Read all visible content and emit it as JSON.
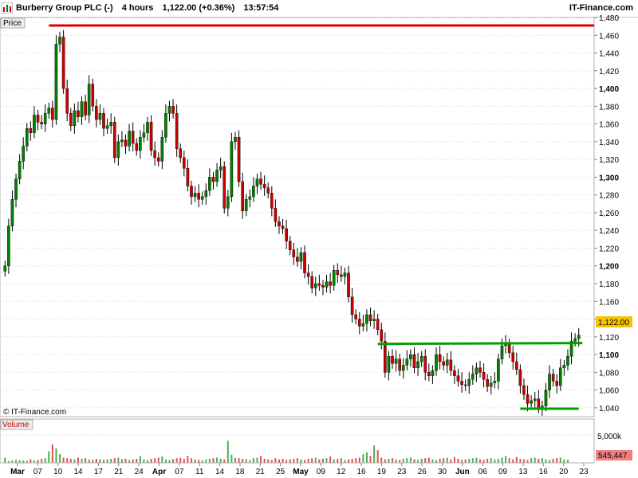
{
  "header": {
    "symbol": "Burberry Group PLC (-)",
    "timeframe": "4 hours",
    "quote": "1,122.00 (+0.36%)",
    "time": "13:57:54",
    "brand": "IT-Finance.com"
  },
  "price_panel": {
    "label": "Price",
    "watermark": "© IT-Finance.com",
    "last_price_label": "1,122.00"
  },
  "volume_panel": {
    "label": "Volume",
    "axis_label": "5,000k",
    "last_volume_label": "545,447"
  },
  "colors": {
    "up": "#008000",
    "down": "#cc0000",
    "resistance_line": "#e00000",
    "support_line": "#00a000",
    "price_badge": "#f5c400",
    "volume_badge": "#f08080"
  },
  "chart_data": {
    "type": "candlestick",
    "title": "Burberry Group PLC (-)",
    "interval": "4 hours",
    "ylim": [
      1030,
      1480
    ],
    "y_ticks": [
      "1,040",
      "1,060",
      "1,080",
      "1,100",
      "1,120",
      "1,140",
      "1,160",
      "1,180",
      "1,200",
      "1,220",
      "1,240",
      "1,260",
      "1,280",
      "1,300",
      "1,320",
      "1,340",
      "1,360",
      "1,380",
      "1,400",
      "1,420",
      "1,440",
      "1,460",
      "1,480"
    ],
    "y_ticks_bold": [
      "1,100",
      "1,200",
      "1,300",
      "1,400"
    ],
    "x_ticks": [
      "Mar",
      "07",
      "10",
      "14",
      "17",
      "21",
      "24",
      "Apr",
      "07",
      "11",
      "14",
      "18",
      "21",
      "25",
      "May",
      "09",
      "12",
      "16",
      "19",
      "23",
      "26",
      "30",
      "Jun",
      "06",
      "09",
      "13",
      "16",
      "20",
      "23"
    ],
    "x_ticks_bold": [
      "Mar",
      "Apr",
      "May",
      "Jun"
    ],
    "horizontal_lines": [
      {
        "name": "resistance",
        "price": 1471,
        "x_start_index": 12,
        "x_end_index": null
      },
      {
        "name": "support-mid",
        "price_start": 1112,
        "price_end": 1113,
        "x_start_index": 102,
        "x_end_index": 158
      },
      {
        "name": "support-low",
        "price": 1039,
        "x_start_index": 141,
        "x_end_index": 157
      }
    ],
    "last_price": 1122.0,
    "volume_ylim": [
      0,
      7000
    ],
    "closes": [
      1200,
      1245,
      1275,
      1298,
      1318,
      1335,
      1355,
      1350,
      1370,
      1362,
      1360,
      1372,
      1378,
      1365,
      1450,
      1458,
      1400,
      1372,
      1358,
      1375,
      1368,
      1385,
      1370,
      1405,
      1380,
      1365,
      1372,
      1355,
      1358,
      1362,
      1322,
      1340,
      1342,
      1335,
      1352,
      1338,
      1330,
      1345,
      1350,
      1362,
      1330,
      1322,
      1318,
      1345,
      1372,
      1380,
      1372,
      1332,
      1322,
      1310,
      1290,
      1278,
      1282,
      1275,
      1278,
      1285,
      1300,
      1295,
      1308,
      1312,
      1265,
      1278,
      1340,
      1345,
      1295,
      1262,
      1275,
      1278,
      1290,
      1298,
      1292,
      1288,
      1282,
      1265,
      1250,
      1245,
      1242,
      1228,
      1218,
      1210,
      1205,
      1215,
      1192,
      1188,
      1175,
      1180,
      1178,
      1176,
      1182,
      1178,
      1195,
      1190,
      1188,
      1192,
      1165,
      1145,
      1140,
      1132,
      1135,
      1145,
      1138,
      1140,
      1128,
      1115,
      1080,
      1098,
      1090,
      1095,
      1082,
      1088,
      1095,
      1100,
      1085,
      1092,
      1098,
      1080,
      1076,
      1082,
      1100,
      1092,
      1088,
      1094,
      1082,
      1076,
      1070,
      1066,
      1065,
      1072,
      1078,
      1085,
      1080,
      1072,
      1064,
      1068,
      1070,
      1095,
      1110,
      1112,
      1102,
      1092,
      1083,
      1065,
      1055,
      1045,
      1048,
      1050,
      1040,
      1042,
      1060,
      1078,
      1070,
      1065,
      1085,
      1088,
      1098,
      1115,
      1118,
      1122
    ],
    "volumes": [
      900,
      300,
      400,
      500,
      450,
      400,
      350,
      600,
      400,
      500,
      700,
      800,
      2000,
      3200,
      2500,
      1500,
      900,
      800,
      700,
      600,
      900,
      700,
      800,
      600,
      500,
      700,
      650,
      500,
      600,
      700,
      800,
      900,
      650,
      700,
      500,
      600,
      700,
      1200,
      600,
      500,
      700,
      800,
      900,
      1100,
      600,
      500,
      650,
      800,
      900,
      700,
      1200,
      800,
      600,
      500,
      450,
      600,
      700,
      800,
      900,
      700,
      600,
      3800,
      1400,
      900,
      800,
      700,
      650,
      500,
      800,
      900,
      1200,
      700,
      600,
      500,
      800,
      600,
      700,
      500,
      600,
      700,
      800,
      600,
      500,
      700,
      800,
      900,
      600,
      700,
      800,
      1100,
      600,
      700,
      800,
      500,
      600,
      700,
      800,
      900,
      1500,
      1800,
      1200,
      3000,
      2200,
      900,
      600,
      700,
      800,
      600,
      500,
      700,
      800,
      900,
      600,
      500,
      700,
      800,
      900,
      600,
      500,
      700,
      800,
      900,
      600,
      1000,
      700,
      500,
      600,
      700,
      800,
      900,
      600,
      500,
      700,
      800,
      600,
      700,
      900,
      1200,
      800,
      600,
      1000,
      700,
      600,
      500,
      800,
      900,
      700,
      800,
      600,
      500,
      700,
      800,
      900,
      600,
      550
    ]
  }
}
